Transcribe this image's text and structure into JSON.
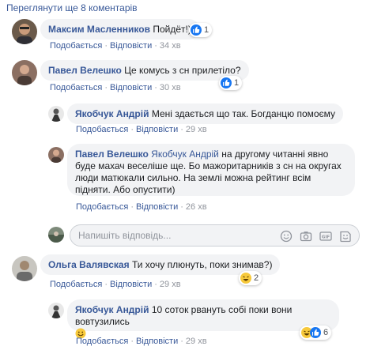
{
  "more_comments_label": "Переглянути ще 8 коментарів",
  "comments": [
    {
      "author": "Максим Масленников",
      "text": "Пойдёт!)",
      "like_label": "Подобається",
      "reply_label": "Відповісти",
      "time": "34 хв",
      "reaction": {
        "type": "like",
        "count": "1"
      }
    },
    {
      "author": "Павел Велешко",
      "text": "Це комусь з сн прилетіло?",
      "like_label": "Подобається",
      "reply_label": "Відповісти",
      "time": "30 хв",
      "reaction": {
        "type": "like",
        "count": "1"
      }
    },
    {
      "author": "Якобчук Андрій",
      "text": "Мені здається що так. Богданцю помоєму",
      "like_label": "Подобається",
      "reply_label": "Відповісти",
      "time": "29 хв"
    },
    {
      "author": "Павел Велешко",
      "mention": "Якобчук Андрій",
      "text": "на другому читанні явно буде махач веселіше ще. Бо мажоритарників з сн на округах люди матюкали сильно. На землі можна рейтинг всім підняти. Або опустити)",
      "like_label": "Подобається",
      "reply_label": "Відповісти",
      "time": "26 хв"
    },
    {
      "author": "Ольга Валявская",
      "text": "Ти хочу плюнуть, поки знимав?)",
      "like_label": "Подобається",
      "reply_label": "Відповісти",
      "time": "29 хв",
      "reaction": {
        "type": "haha",
        "count": "2"
      }
    },
    {
      "author": "Якобчук Андрій",
      "text": "10 соток рвануть собі поки вони вовтузились",
      "like_label": "Подобається",
      "reply_label": "Відповісти",
      "time": "29 хв",
      "reaction": {
        "type": "haha-like",
        "count": "6"
      }
    }
  ],
  "reply_box": {
    "placeholder": "Напишіть відповідь...",
    "tools": [
      "emoji-icon",
      "camera-icon",
      "gif-icon",
      "sticker-icon"
    ]
  },
  "colors": {
    "link": "#385898",
    "bubble": "#f2f3f5",
    "meta": "#90949c",
    "like": "#1877f2",
    "haha": "#f7c93b"
  }
}
